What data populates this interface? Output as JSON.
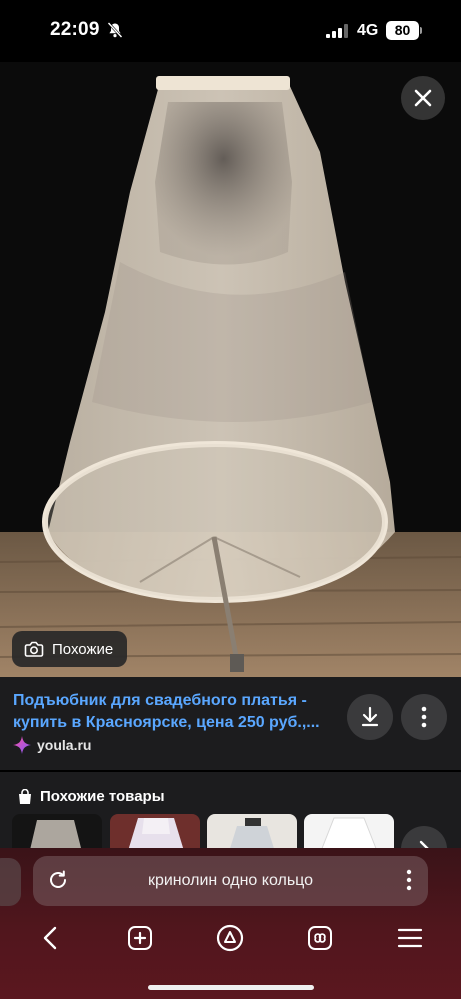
{
  "status": {
    "time": "22:09",
    "network": "4G",
    "battery": "80"
  },
  "image_actions": {
    "similar_label": "Похожие"
  },
  "result": {
    "title_line1": "Подъюбник для свадебного платья -",
    "title_line2": "купить в Красноярске, цена 250 руб.,...",
    "source": "youla.ru"
  },
  "similar_products": {
    "title": "Похожие товары"
  },
  "search": {
    "query": "кринолин одно кольцо"
  },
  "colors": {
    "link": "#5aa7ff",
    "panel": "#1c1c1e",
    "bottom_bar": "#51161d"
  }
}
